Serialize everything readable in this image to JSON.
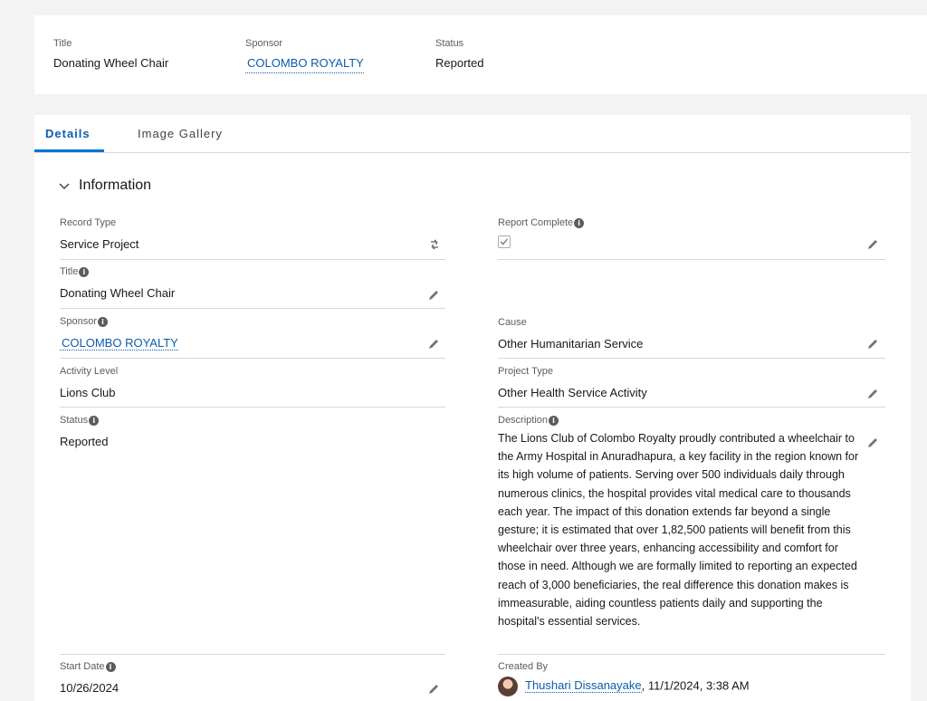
{
  "highlights": {
    "title_label": "Title",
    "title_value": "Donating Wheel Chair",
    "sponsor_label": "Sponsor",
    "sponsor_value": "COLOMBO ROYALTY",
    "status_label": "Status",
    "status_value": "Reported"
  },
  "tabs": [
    {
      "label": "Details",
      "active": true
    },
    {
      "label": "Image Gallery",
      "active": false
    }
  ],
  "section": {
    "title": "Information"
  },
  "fields": {
    "record_type": {
      "label": "Record Type",
      "value": "Service Project"
    },
    "report_complete": {
      "label": "Report Complete",
      "checked": true
    },
    "title": {
      "label": "Title",
      "value": "Donating Wheel Chair"
    },
    "sponsor": {
      "label": "Sponsor",
      "value": "COLOMBO ROYALTY"
    },
    "cause": {
      "label": "Cause",
      "value": "Other Humanitarian Service"
    },
    "activity_level": {
      "label": "Activity Level",
      "value": "Lions Club"
    },
    "project_type": {
      "label": "Project Type",
      "value": "Other Health Service Activity"
    },
    "status": {
      "label": "Status",
      "value": "Reported"
    },
    "description": {
      "label": "Description",
      "value": "The Lions Club of Colombo Royalty proudly contributed a wheelchair to the Army Hospital in Anuradhapura, a key facility in the region known for its high volume of patients. Serving over 500 individuals daily through numerous clinics, the hospital provides vital medical care to thousands each year. The impact of this donation extends far beyond a single gesture; it is estimated that over 1,82,500 patients will benefit from this wheelchair over three years, enhancing accessibility and comfort for those in need. Although we are formally limited to reporting an expected reach of 3,000 beneficiaries, the real difference this donation makes is immeasurable, aiding countless patients daily and supporting the hospital's essential services."
    },
    "start_date": {
      "label": "Start Date",
      "value": "10/26/2024"
    },
    "created_by": {
      "label": "Created By",
      "user": "Thushari Dissanayake",
      "timestamp": ", 11/1/2024, 3:38 AM"
    }
  },
  "icons": {
    "info": "info-icon",
    "edit": "pencil-icon",
    "change_record_type": "change-record-type-icon",
    "chevron": "chevron-down-icon"
  },
  "colors": {
    "link": "#0b5cab",
    "tab_active": "#0176d3",
    "background": "#f3f3f3"
  }
}
